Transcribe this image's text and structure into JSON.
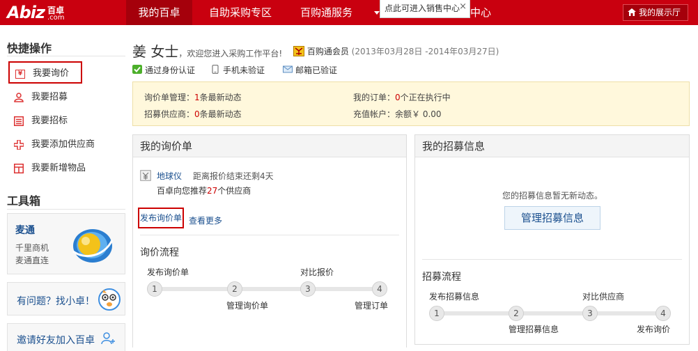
{
  "header": {
    "logo_main": "Abiz",
    "logo_cn": "百卓",
    "logo_com": ".com",
    "nav": [
      {
        "label": "我的百卓"
      },
      {
        "label": "自助采购专区"
      },
      {
        "label": "百购通服务"
      },
      {
        "label": "中心"
      }
    ],
    "tooltip": "点此可进入销售中心",
    "tooltip_close": "×",
    "showroom": "我的展示厅",
    "colors": {
      "brand": "#c9000f",
      "nav_active": "#a5000b"
    }
  },
  "sidebar": {
    "quick_title": "快捷操作",
    "quick_items": [
      {
        "label": "我要询价",
        "icon": "yuan-icon"
      },
      {
        "label": "我要招募",
        "icon": "person-icon"
      },
      {
        "label": "我要招标",
        "icon": "list-icon"
      },
      {
        "label": "我要添加供应商",
        "icon": "plus-icon"
      },
      {
        "label": "我要新增物品",
        "icon": "box-icon"
      }
    ],
    "toolbox_title": "工具箱",
    "maitong": {
      "title": "麦通",
      "line1": "千里商机",
      "line2": "麦通直连"
    },
    "help": "有问题？找小卓！",
    "invite": "邀请好友加入百卓"
  },
  "profile": {
    "name": "姜 女士",
    "welcome": "，欢迎您进入采购工作平台!",
    "member_label": "百购通会员",
    "member_period": "(2013年03月28日 -2014年03月27日)",
    "verifications": [
      "通过身份认证",
      "手机未验证",
      "邮箱已验证"
    ]
  },
  "stats": {
    "inquiry_label": "询价单管理：",
    "inquiry_count": "1",
    "inquiry_suffix": "条最新动态",
    "orders_label": "我的订单：",
    "orders_count": "0",
    "orders_suffix": "个正在执行中",
    "recruit_label": "招募供应商：",
    "recruit_count": "0",
    "recruit_suffix": "条最新动态",
    "recharge_label": "充值帐户：余额￥ 0.00"
  },
  "inquiry_panel": {
    "title": "我的询价单",
    "item_name": "地球仪",
    "item_deadline": "距离报价结束还剩4天",
    "recommend_prefix": "百卓向您推荐",
    "recommend_count": "27",
    "recommend_suffix": "个供应商",
    "publish_link": "发布询价单",
    "more_link": "查看更多",
    "flow_title": "询价流程",
    "steps": [
      {
        "num": "1",
        "label": "发布询价单"
      },
      {
        "num": "2",
        "label": "管理询价单"
      },
      {
        "num": "3",
        "label": "对比报价"
      },
      {
        "num": "4",
        "label": "管理订单"
      }
    ]
  },
  "recruit_panel": {
    "title": "我的招募信息",
    "empty_text": "您的招募信息暂无新动态。",
    "manage_button": "管理招募信息",
    "flow_title": "招募流程",
    "steps": [
      {
        "num": "1",
        "label": "发布招募信息"
      },
      {
        "num": "2",
        "label": "管理招募信息"
      },
      {
        "num": "3",
        "label": "对比供应商"
      },
      {
        "num": "4",
        "label": "发布询价"
      }
    ]
  }
}
